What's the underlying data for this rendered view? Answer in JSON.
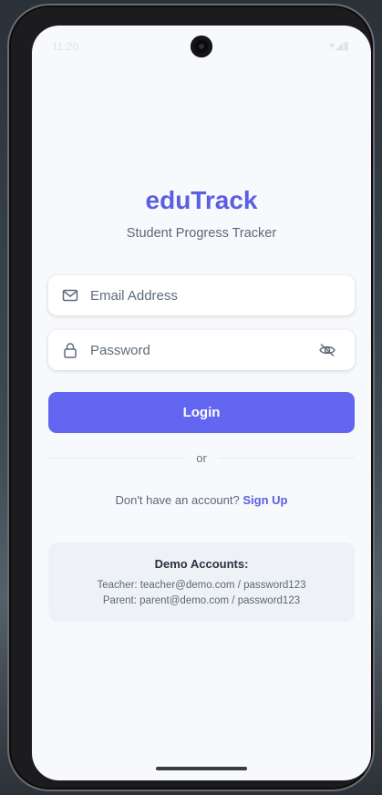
{
  "status": {
    "time": "11:20",
    "signal": "▾◢▮"
  },
  "app": {
    "brand": "eduTrack",
    "tagline": "Student Progress Tracker"
  },
  "form": {
    "email_placeholder": "Email Address",
    "password_placeholder": "Password",
    "login_label": "Login",
    "divider_text": "or",
    "signup_prompt": "Don't have an account?",
    "signup_link": "Sign Up"
  },
  "demo": {
    "title": "Demo Accounts:",
    "teacher": "Teacher: teacher@demo.com / password123",
    "parent": "Parent: parent@demo.com / password123"
  },
  "icons": {
    "email": "mail-icon",
    "password": "lock-icon",
    "visibility": "eye-off-icon"
  },
  "colors": {
    "accent": "#6366f1",
    "brand": "#5b5fe0",
    "background": "#f7f9fc",
    "demo_box": "#eef2f7"
  }
}
